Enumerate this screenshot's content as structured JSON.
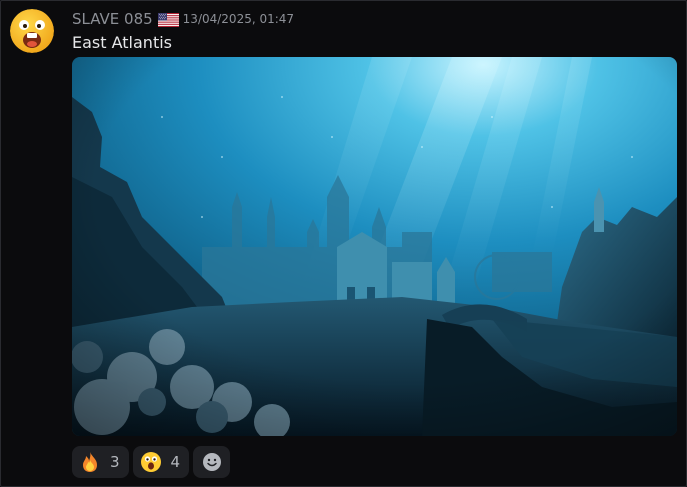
{
  "message": {
    "author": "SLAVE 085",
    "flag_icon": "us-flag-icon",
    "timestamp": "13/04/2025, 01:47",
    "text": "East Atlantis",
    "attachment": {
      "type": "image",
      "alt": "East Atlantis"
    },
    "reactions": [
      {
        "emoji": "fire-emoji-icon",
        "count": "3"
      },
      {
        "emoji": "astonished-emoji-icon",
        "count": "4"
      }
    ],
    "add_reaction_icon": "add-reaction-icon"
  },
  "colors": {
    "background": "#0b0b0d",
    "username": "#8c8f96",
    "timestamp": "#8d9097",
    "message_text": "#e6e7e9",
    "reaction_bg": "#1f2024"
  }
}
